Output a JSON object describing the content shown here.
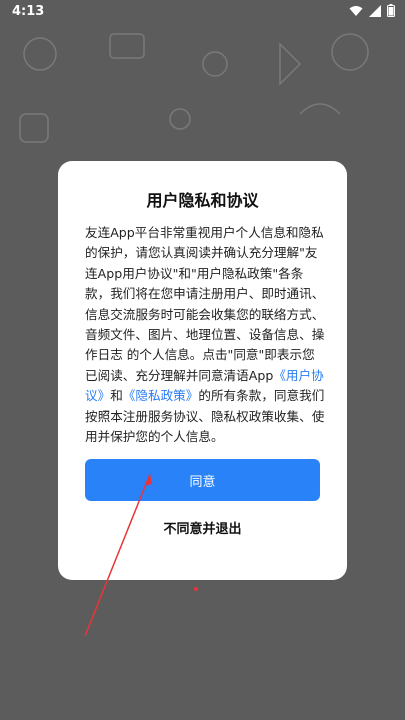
{
  "status_bar": {
    "time": "4:13",
    "icons": [
      "wifi-icon",
      "signal-icon",
      "battery-icon"
    ]
  },
  "dialog": {
    "title": "用户隐私和协议",
    "body_part1": "友连App平台非常重视用户个人信息和隐私的保护，请您认真阅读并确认充分理解\"友连App用户协议\"和\"用户隐私政策\"各条款，我们将在您申请注册用户、即时通讯、信息交流服务时可能会收集您的联络方式、音频文件、图片、地理位置、设备信息、操作日志 的个人信息。点击\"同意\"即表示您已阅读、充分理解并同意清语App",
    "link_user_agreement": "《用户协议》",
    "body_and": "和",
    "link_privacy_policy": "《隐私政策》",
    "body_part2": "的所有条款，同意我们按照本注册服务协议、隐私权政策收集、使用并保护您的个人信息。",
    "agree_label": "同意",
    "disagree_label": "不同意并退出"
  },
  "colors": {
    "overlay": "#5c5c5c",
    "primary": "#2a82f8",
    "link": "#2a7cf6",
    "annotation": "#e8353a"
  }
}
